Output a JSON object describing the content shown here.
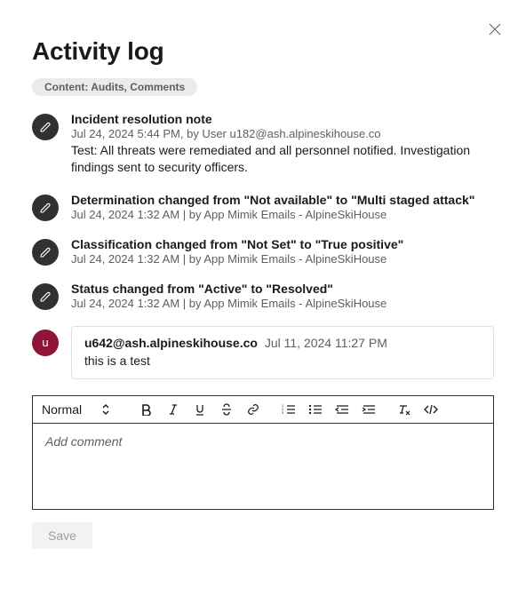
{
  "header": {
    "title": "Activity log"
  },
  "filter": {
    "label": "Content: Audits, Comments"
  },
  "entries": [
    {
      "title": "Incident resolution note",
      "meta": "Jul 24, 2024 5:44 PM, by User u182@ash.alpineskihouse.co",
      "text": "Test: All threats were remediated and all personnel notified. Investigation findings sent to security officers."
    },
    {
      "title": "Determination changed from \"Not available\" to \"Multi staged attack\"",
      "meta": "Jul 24, 2024 1:32 AM | by App Mimik Emails - AlpineSkiHouse"
    },
    {
      "title": "Classification changed from \"Not Set\" to \"True positive\"",
      "meta": "Jul 24, 2024 1:32 AM | by App Mimik Emails - AlpineSkiHouse"
    },
    {
      "title": "Status changed from \"Active\" to \"Resolved\"",
      "meta": "Jul 24, 2024 1:32 AM | by App Mimik Emails - AlpineSkiHouse"
    }
  ],
  "comment": {
    "avatar_initial": "u",
    "author": "u642@ash.alpineskihouse.co",
    "time": "Jul 11, 2024 11:27 PM",
    "body": "this is a test"
  },
  "editor": {
    "style_label": "Normal",
    "placeholder": "Add comment"
  },
  "actions": {
    "save_label": "Save"
  }
}
